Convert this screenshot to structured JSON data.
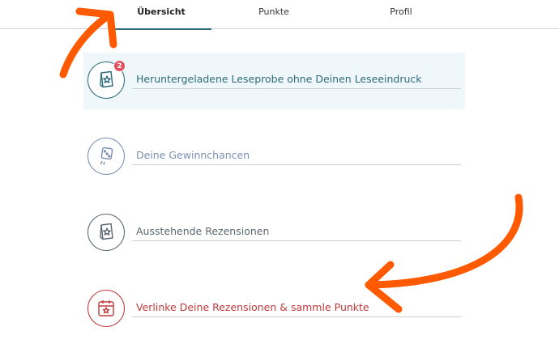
{
  "tabs": [
    {
      "label": "Übersicht",
      "active": true
    },
    {
      "label": "Punkte",
      "active": false
    },
    {
      "label": "Profil",
      "active": false
    }
  ],
  "menu": {
    "items": [
      {
        "label": "Heruntergeladene Leseprobe ohne Deinen Leseeindruck",
        "icon": "book-star-icon",
        "badge": "2",
        "color": "#2d6a7a"
      },
      {
        "label": "Deine Gewinnchancen",
        "icon": "dice-icon",
        "color": "#7b8fb3"
      },
      {
        "label": "Ausstehende Rezensionen",
        "icon": "book-star-icon",
        "color": "#5b6670"
      },
      {
        "label": "Verlinke Deine Rezensionen & sammle Punkte",
        "icon": "calendar-star-icon",
        "color": "#c0393b"
      }
    ]
  },
  "colors": {
    "accent": "#2d6a7a",
    "annotation": "#ff5a00",
    "highlight_bg": "#f0f7fb"
  }
}
